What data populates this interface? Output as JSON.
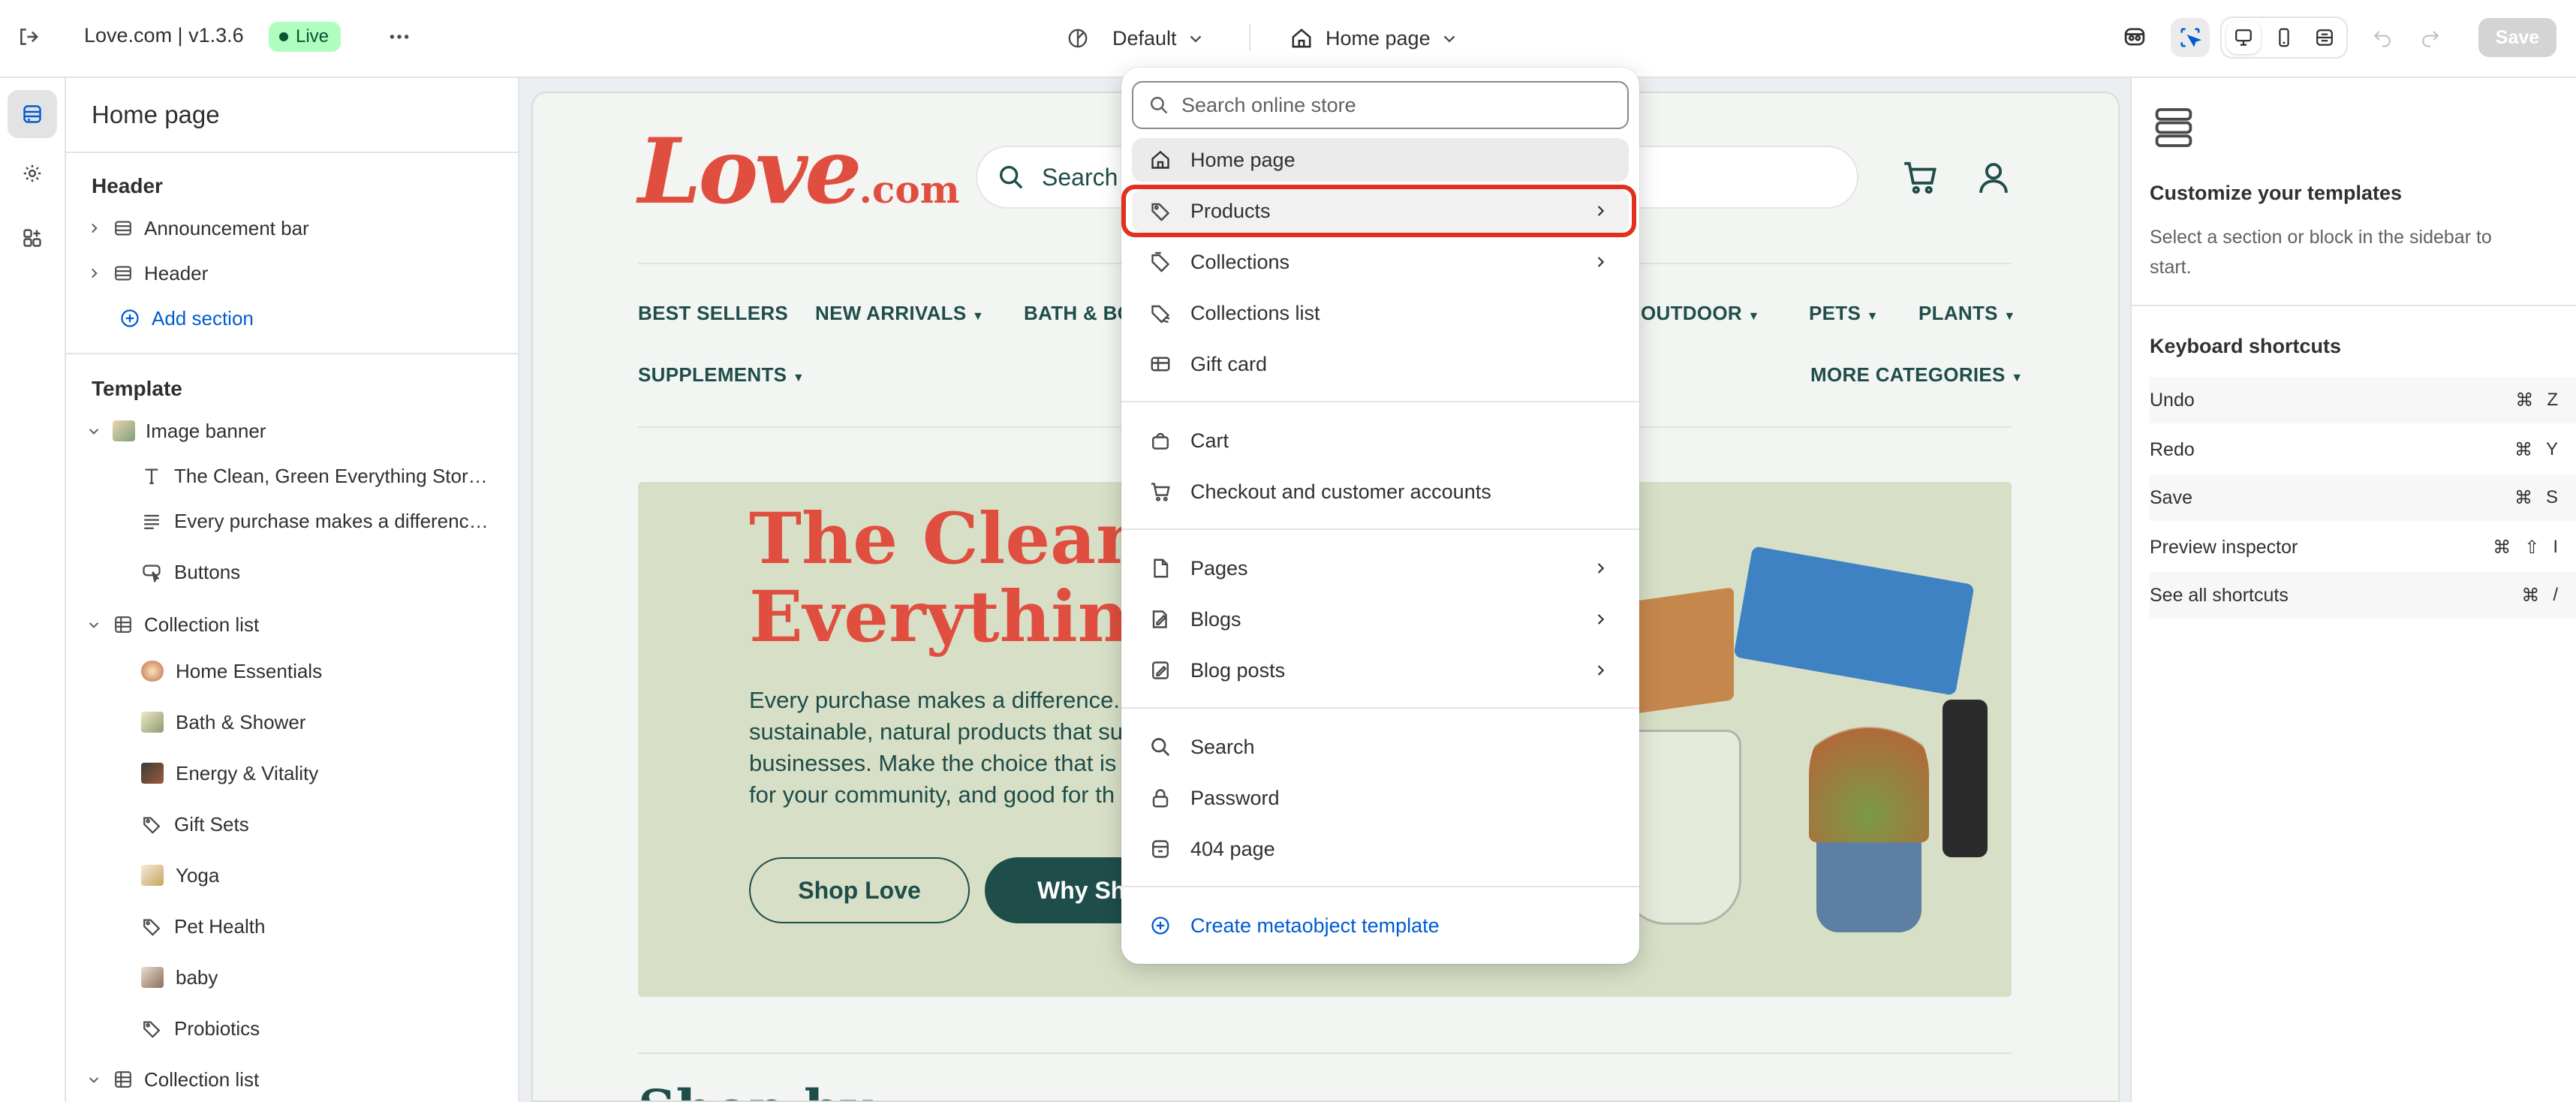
{
  "topbar": {
    "store_name": "Love.com | v1.3.6",
    "status_badge": "Live",
    "theme_select": "Default",
    "page_select": "Home page",
    "save_label": "Save"
  },
  "sidebar": {
    "title": "Home page",
    "header_group": "Header",
    "header_items": [
      "Announcement bar",
      "Header"
    ],
    "add_section": "Add section",
    "template_group": "Template",
    "image_banner": "Image banner",
    "image_banner_blocks": [
      "The Clean, Green Everything Store ...",
      "Every purchase makes a difference...",
      "Buttons"
    ],
    "collection_list": "Collection list",
    "collection_blocks": [
      "Home Essentials",
      "Bath & Shower",
      "Energy & Vitality",
      "Gift Sets",
      "Yoga",
      "Pet Health",
      "baby",
      "Probiotics"
    ],
    "collection_list_2": "Collection list"
  },
  "store": {
    "logo_main": "Love",
    "logo_suffix": ".com",
    "search_placeholder": "Search",
    "nav": [
      "BEST SELLERS",
      "NEW ARRIVALS",
      "BATH & BO",
      "OUTDOOR",
      "PETS",
      "PLANTS"
    ],
    "nav2": [
      "SUPPLEMENTS",
      "MORE CATEGORIES"
    ],
    "hero_heading_line1": "The Clean, G",
    "hero_heading_line2": "Everything",
    "hero_body_lines": [
      "Every purchase makes a difference.",
      "sustainable, natural products that su",
      "businesses.  Make the choice that is",
      "for your community, and good for th"
    ],
    "btn_shop": "Shop Love",
    "btn_why": "Why Sh",
    "below_heading": "Shop by"
  },
  "dropdown": {
    "search_placeholder": "Search online store",
    "items_a": [
      "Home page",
      "Products",
      "Collections",
      "Collections list",
      "Gift card"
    ],
    "items_b": [
      "Cart",
      "Checkout and customer accounts"
    ],
    "items_c": [
      "Pages",
      "Blogs",
      "Blog posts"
    ],
    "items_d": [
      "Search",
      "Password",
      "404 page"
    ],
    "create_link": "Create metaobject template"
  },
  "right_panel": {
    "title": "Customize your templates",
    "description_lines": [
      "Select a section or block in the sidebar to",
      "start."
    ],
    "shortcuts_title": "Keyboard shortcuts",
    "shortcuts": [
      {
        "label": "Undo",
        "keys": [
          "⌘",
          "Z"
        ]
      },
      {
        "label": "Redo",
        "keys": [
          "⌘",
          "Y"
        ]
      },
      {
        "label": "Save",
        "keys": [
          "⌘",
          "S"
        ]
      },
      {
        "label": "Preview inspector",
        "keys": [
          "⌘",
          "⇧",
          "I"
        ]
      },
      {
        "label": "See all shortcuts",
        "keys": [
          "⌘",
          "/"
        ]
      }
    ]
  },
  "colors": {
    "accent_blue": "#005bd3",
    "live_green": "#affebf",
    "brand_red": "#e04e3f",
    "brand_teal": "#1f4d4a",
    "hero_bg": "#d7dfc6",
    "highlight_red": "#e0311f"
  }
}
